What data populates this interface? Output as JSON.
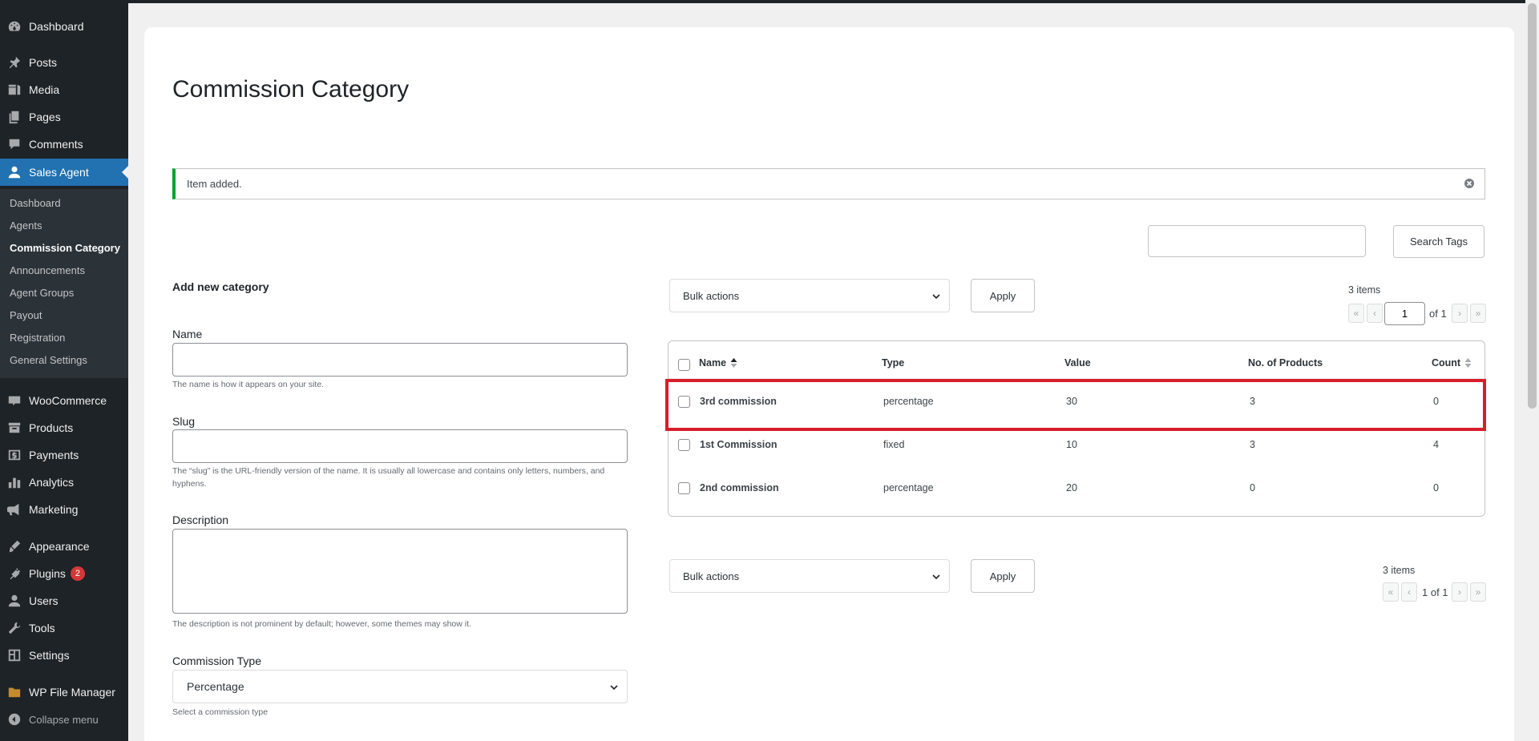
{
  "sidebar": {
    "top_items": [
      {
        "label": "Dashboard",
        "icon": "dashboard-icon"
      },
      {
        "label": "Posts",
        "icon": "pin-icon"
      },
      {
        "label": "Media",
        "icon": "media-icon"
      },
      {
        "label": "Pages",
        "icon": "pages-icon"
      },
      {
        "label": "Comments",
        "icon": "comment-icon"
      },
      {
        "label": "Sales Agent",
        "icon": "user-icon"
      }
    ],
    "submenu": [
      "Dashboard",
      "Agents",
      "Commission Category",
      "Announcements",
      "Agent Groups",
      "Payout",
      "Registration",
      "General Settings"
    ],
    "bottom_items": [
      {
        "label": "WooCommerce",
        "icon": "woo-icon"
      },
      {
        "label": "Products",
        "icon": "archive-icon"
      },
      {
        "label": "Payments",
        "icon": "dollar-icon"
      },
      {
        "label": "Analytics",
        "icon": "bar-chart-icon"
      },
      {
        "label": "Marketing",
        "icon": "megaphone-icon"
      },
      {
        "label": "Appearance",
        "icon": "brush-icon"
      },
      {
        "label": "Plugins",
        "icon": "plugin-icon",
        "badge": "2"
      },
      {
        "label": "Users",
        "icon": "users-icon"
      },
      {
        "label": "Tools",
        "icon": "wrench-icon"
      },
      {
        "label": "Settings",
        "icon": "settings-icon"
      },
      {
        "label": "WP File Manager",
        "icon": "folder-icon"
      }
    ],
    "collapse_label": "Collapse menu",
    "accent": "#2271b1"
  },
  "page": {
    "title": "Commission Category",
    "notice": "Item added.",
    "search_button": "Search Tags"
  },
  "form": {
    "heading": "Add new category",
    "name_label": "Name",
    "name_help": "The name is how it appears on your site.",
    "slug_label": "Slug",
    "slug_help": "The “slug” is the URL-friendly version of the name. It is usually all lowercase and contains only letters, numbers, and hyphens.",
    "description_label": "Description",
    "description_help": "The description is not prominent by default; however, some themes may show it.",
    "type_label": "Commission Type",
    "type_value": "Percentage",
    "type_help": "Select a commission type"
  },
  "list": {
    "bulk_label": "Bulk actions",
    "apply_label": "Apply",
    "items_count": "3 items",
    "current_page": "1",
    "of_pages": "of 1",
    "bottom_pages": "1 of 1",
    "pg_first": "«",
    "pg_prev": "‹",
    "pg_next": "›",
    "pg_last": "»",
    "columns": [
      "Name",
      "Type",
      "Value",
      "No. of Products",
      "Count"
    ],
    "rows": [
      {
        "name": "3rd commission",
        "type": "percentage",
        "value": "30",
        "products": "3",
        "count": "0"
      },
      {
        "name": "1st Commission",
        "type": "fixed",
        "value": "10",
        "products": "3",
        "count": "4"
      },
      {
        "name": "2nd commission",
        "type": "percentage",
        "value": "20",
        "products": "0",
        "count": "0"
      }
    ],
    "highlight_color": "#d61e2b"
  },
  "colors": {
    "success": "#00a32a",
    "admin_bg": "#1d2327",
    "badge": "#d63638"
  }
}
